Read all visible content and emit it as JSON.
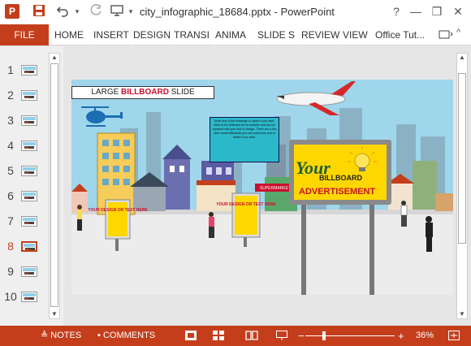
{
  "titlebar": {
    "app_icon": "P",
    "save_icon": "save-icon",
    "undo_icon": "undo-icon",
    "redo_icon": "redo-icon",
    "title": "city_infographic_18684.pptx - PowerPoint",
    "help": "?",
    "minimize": "—",
    "restore": "❐",
    "close": "✕"
  },
  "ribbon": {
    "file": "FILE",
    "tabs": [
      "HOME",
      "INSERT",
      "DESIGN",
      "TRANSI",
      "ANIMA",
      "SLIDE S",
      "REVIEW",
      "VIEW"
    ],
    "user": "Office Tut..."
  },
  "thumbnails": [
    {
      "num": "1"
    },
    {
      "num": "2"
    },
    {
      "num": "3"
    },
    {
      "num": "4"
    },
    {
      "num": "5"
    },
    {
      "num": "6"
    },
    {
      "num": "7"
    },
    {
      "num": "8",
      "selected": true
    },
    {
      "num": "9"
    },
    {
      "num": "10"
    }
  ],
  "slide": {
    "title_prefix": "LARGE ",
    "title_accent": "BILLBOARD",
    "title_suffix": " SLIDE",
    "callout": "Move any of the drawings or clipart if you wish. Most of the billboard text is editable and can be replaced with your text or design. There are a few other small billboards you can customize and or delete if you wish.",
    "billboard_your": "Your",
    "billboard_line2": "BILLBOARD",
    "billboard_line3": "ADVERTISEMENT",
    "small_board_1": "YOUR DESIGN OR TEXT HERE",
    "small_board_2": "YOUR DESIGN OR TEXT HERE",
    "shop_sign": "SUPERMARKET"
  },
  "statusbar": {
    "notes": "NOTES",
    "comments": "COMMENTS",
    "zoom_minus": "−",
    "zoom_plus": "+",
    "zoom": "36%"
  },
  "colors": {
    "accent": "#c43e1c",
    "sky": "#9fd6ec",
    "billboard_yellow": "#ffd700"
  }
}
